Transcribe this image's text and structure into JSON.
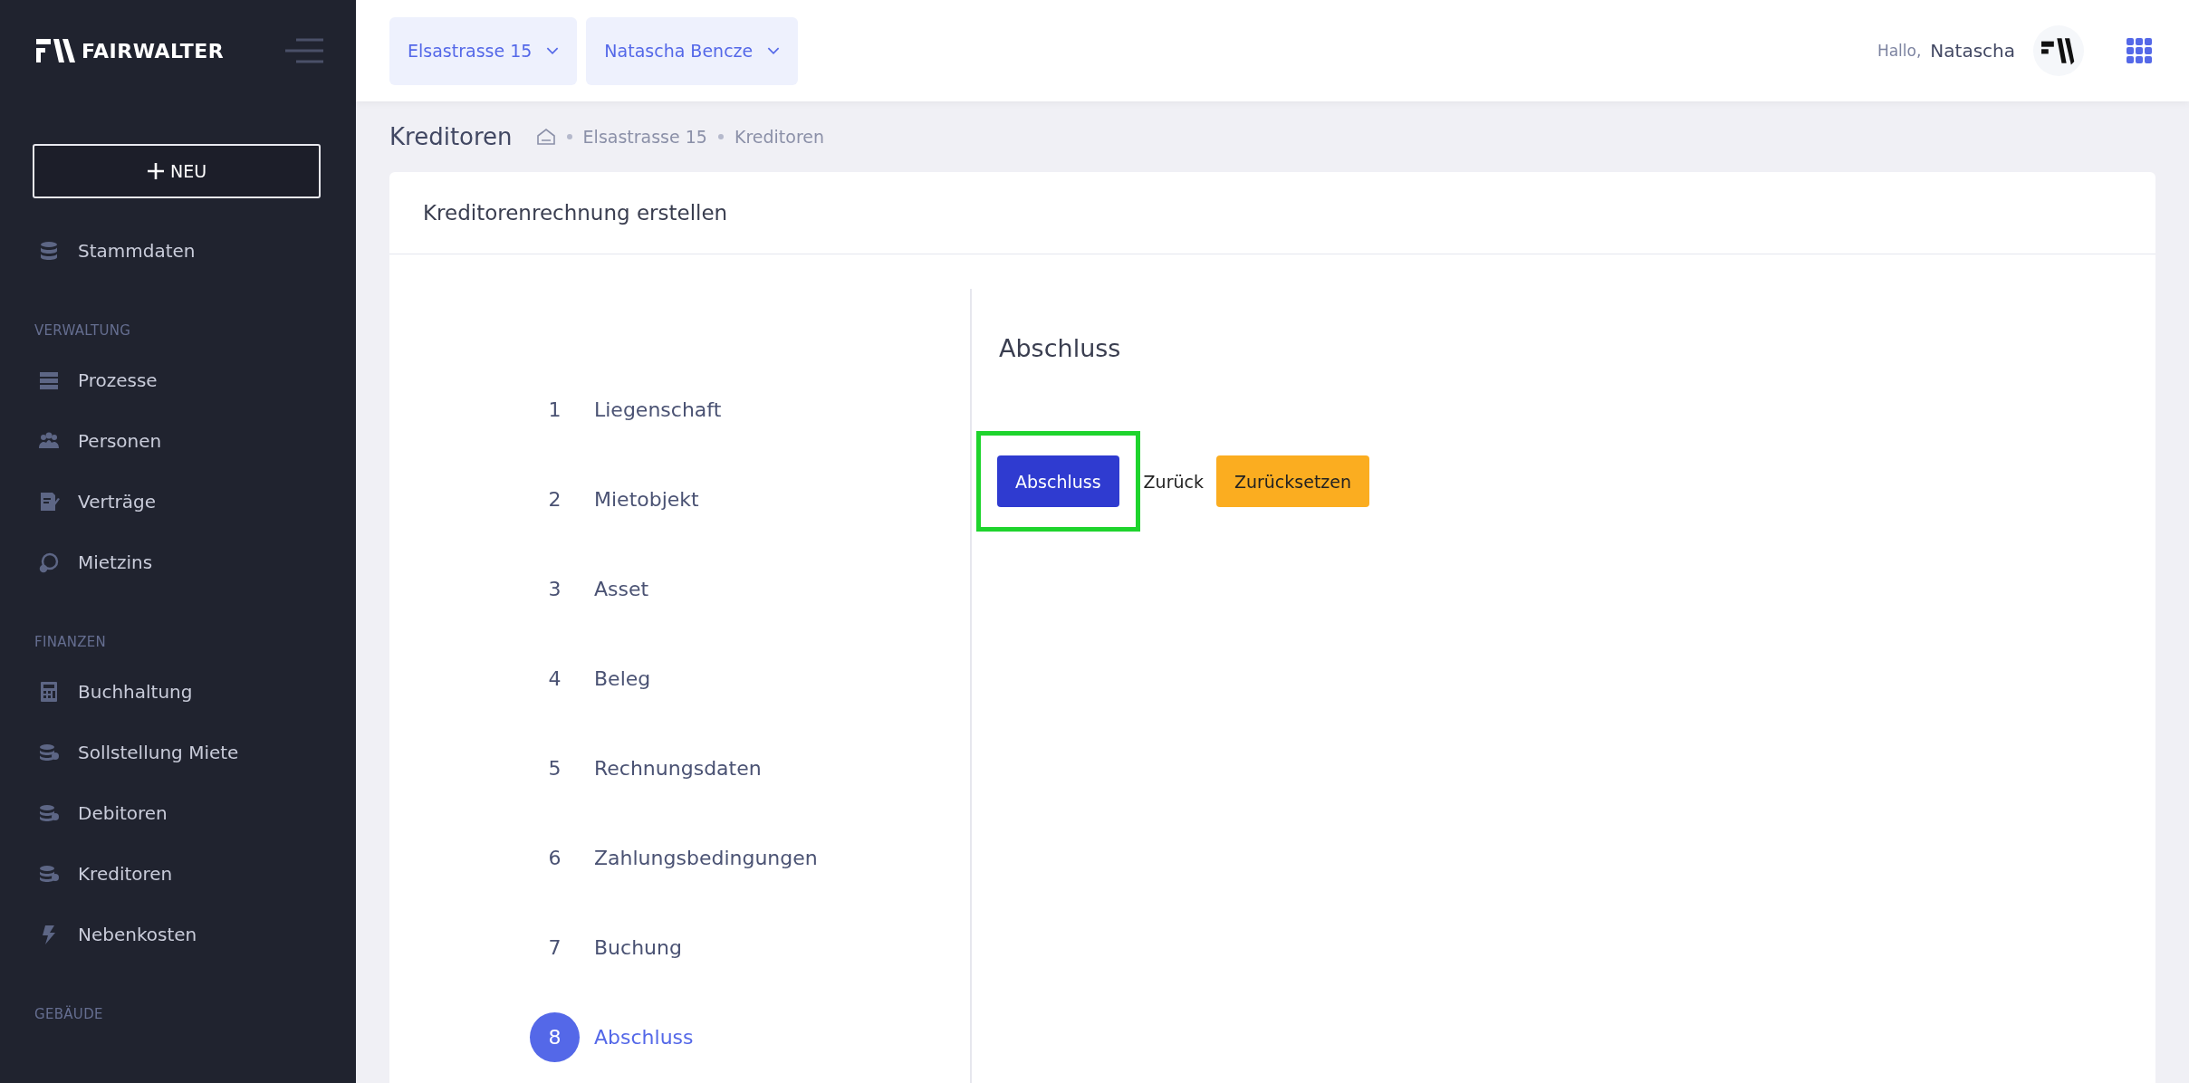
{
  "sidebar": {
    "brand": "FAIRWALTER",
    "new_button": "NEU",
    "sections": [
      {
        "items": [
          "Stammdaten"
        ]
      },
      {
        "heading": "VERWALTUNG",
        "items": [
          "Prozesse",
          "Personen",
          "Verträge",
          "Mietzins"
        ]
      },
      {
        "heading": "FINANZEN",
        "items": [
          "Buchhaltung",
          "Sollstellung Miete",
          "Debitoren",
          "Kreditoren",
          "Nebenkosten"
        ]
      },
      {
        "heading": "GEBÄUDE"
      }
    ]
  },
  "header": {
    "selectors": [
      "Elsastrasse 15",
      "Natascha Bencze"
    ],
    "greeting": "Hallo,",
    "user_name": "Natascha"
  },
  "page": {
    "title": "Kreditoren",
    "breadcrumb": [
      "Elsastrasse 15",
      "Kreditoren"
    ]
  },
  "card": {
    "title": "Kreditorenrechnung erstellen",
    "steps": [
      {
        "number": "1",
        "label": "Liegenschaft",
        "selected": false
      },
      {
        "number": "2",
        "label": "Mietobjekt",
        "selected": false
      },
      {
        "number": "3",
        "label": "Asset",
        "selected": false
      },
      {
        "number": "4",
        "label": "Beleg",
        "selected": false
      },
      {
        "number": "5",
        "label": "Rechnungsdaten",
        "selected": false
      },
      {
        "number": "6",
        "label": "Zahlungsbedingungen",
        "selected": false
      },
      {
        "number": "7",
        "label": "Buchung",
        "selected": false
      },
      {
        "number": "8",
        "label": "Abschluss",
        "selected": true
      }
    ],
    "step_title": "Abschluss",
    "buttons": [
      {
        "label": "Abschluss",
        "kind": "primary",
        "highlighted": true
      },
      {
        "label": "Zurück",
        "kind": "plain",
        "highlighted": false
      },
      {
        "label": "Zurücksetzen",
        "kind": "warning",
        "highlighted": false
      }
    ]
  }
}
